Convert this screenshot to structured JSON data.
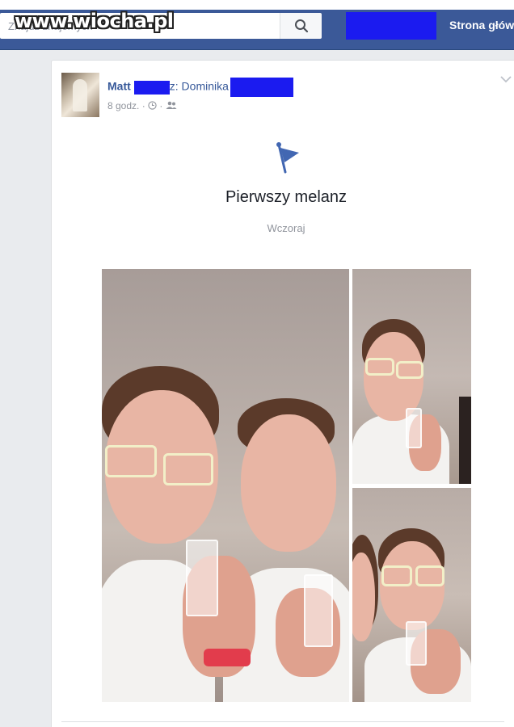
{
  "watermark": "www.wiocha.pl",
  "topbar": {
    "search_placeholder": "Znajdź znajomych",
    "home_link": "Strona główna"
  },
  "post": {
    "author_first": "Matt",
    "with_text": "z: Dominika",
    "time": "8 godz.",
    "event": {
      "title": "Pierwszy melanz",
      "date": "Wczoraj"
    }
  },
  "colors": {
    "facebook_blue": "#3b5998",
    "link_blue": "#365899",
    "redaction_blue": "#1b1bf0",
    "meta_gray": "#90949c"
  },
  "icons": [
    "search-icon",
    "clock-icon",
    "friends-icon",
    "chevron-down-icon",
    "life-event-flag-icon"
  ]
}
